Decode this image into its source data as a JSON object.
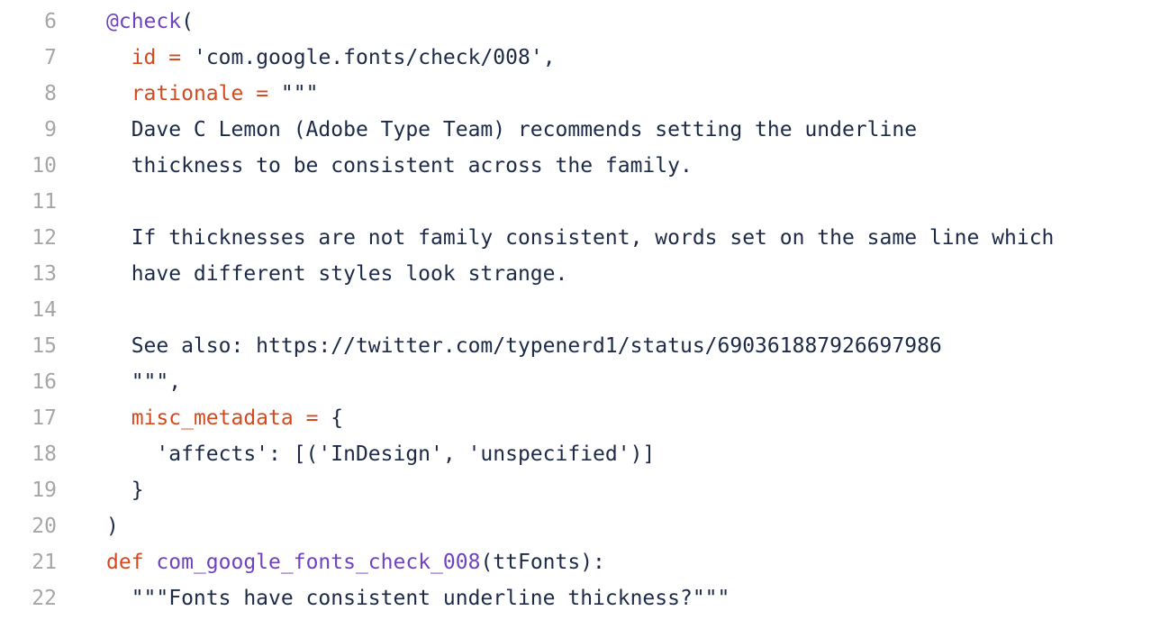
{
  "colors": {
    "keyword": "#d44a1e",
    "decorator": "#6f42c1",
    "function": "#6f42c1",
    "text": "#1c2a47",
    "line_number": "#a6a6a6",
    "background": "#ffffff"
  },
  "lines": [
    {
      "n": "6",
      "tokens": [
        {
          "t": "@check",
          "c": "dec"
        },
        {
          "t": "(",
          "c": "plain"
        }
      ]
    },
    {
      "n": "7",
      "tokens": [
        {
          "t": "  ",
          "c": "plain"
        },
        {
          "t": "id",
          "c": "kw"
        },
        {
          "t": " ",
          "c": "plain"
        },
        {
          "t": "=",
          "c": "kw"
        },
        {
          "t": " 'com.google.fonts/check/008',",
          "c": "plain"
        }
      ]
    },
    {
      "n": "8",
      "tokens": [
        {
          "t": "  ",
          "c": "plain"
        },
        {
          "t": "rationale",
          "c": "kw"
        },
        {
          "t": " ",
          "c": "plain"
        },
        {
          "t": "=",
          "c": "kw"
        },
        {
          "t": " \"\"\"",
          "c": "plain"
        }
      ]
    },
    {
      "n": "9",
      "tokens": [
        {
          "t": "  Dave C Lemon (Adobe Type Team) recommends setting the underline",
          "c": "plain"
        }
      ]
    },
    {
      "n": "10",
      "tokens": [
        {
          "t": "  thickness to be consistent across the family.",
          "c": "plain"
        }
      ]
    },
    {
      "n": "11",
      "tokens": []
    },
    {
      "n": "12",
      "tokens": [
        {
          "t": "  If thicknesses are not family consistent, words set on the same line which",
          "c": "plain"
        }
      ]
    },
    {
      "n": "13",
      "tokens": [
        {
          "t": "  have different styles look strange.",
          "c": "plain"
        }
      ]
    },
    {
      "n": "14",
      "tokens": []
    },
    {
      "n": "15",
      "tokens": [
        {
          "t": "  See also: https://twitter.com/typenerd1/status/690361887926697986",
          "c": "plain"
        }
      ]
    },
    {
      "n": "16",
      "tokens": [
        {
          "t": "  \"\"\",",
          "c": "plain"
        }
      ]
    },
    {
      "n": "17",
      "tokens": [
        {
          "t": "  ",
          "c": "plain"
        },
        {
          "t": "misc_metadata",
          "c": "kw"
        },
        {
          "t": " ",
          "c": "plain"
        },
        {
          "t": "=",
          "c": "kw"
        },
        {
          "t": " {",
          "c": "plain"
        }
      ]
    },
    {
      "n": "18",
      "tokens": [
        {
          "t": "    'affects': [('InDesign', 'unspecified')]",
          "c": "plain"
        }
      ]
    },
    {
      "n": "19",
      "tokens": [
        {
          "t": "  }",
          "c": "plain"
        }
      ]
    },
    {
      "n": "20",
      "tokens": [
        {
          "t": ")",
          "c": "plain"
        }
      ]
    },
    {
      "n": "21",
      "tokens": [
        {
          "t": "def",
          "c": "kw"
        },
        {
          "t": " ",
          "c": "plain"
        },
        {
          "t": "com_google_fonts_check_008",
          "c": "fn"
        },
        {
          "t": "(ttFonts):",
          "c": "plain"
        }
      ]
    },
    {
      "n": "22",
      "tokens": [
        {
          "t": "  \"\"\"Fonts have consistent underline thickness?\"\"\"",
          "c": "plain"
        }
      ]
    }
  ]
}
